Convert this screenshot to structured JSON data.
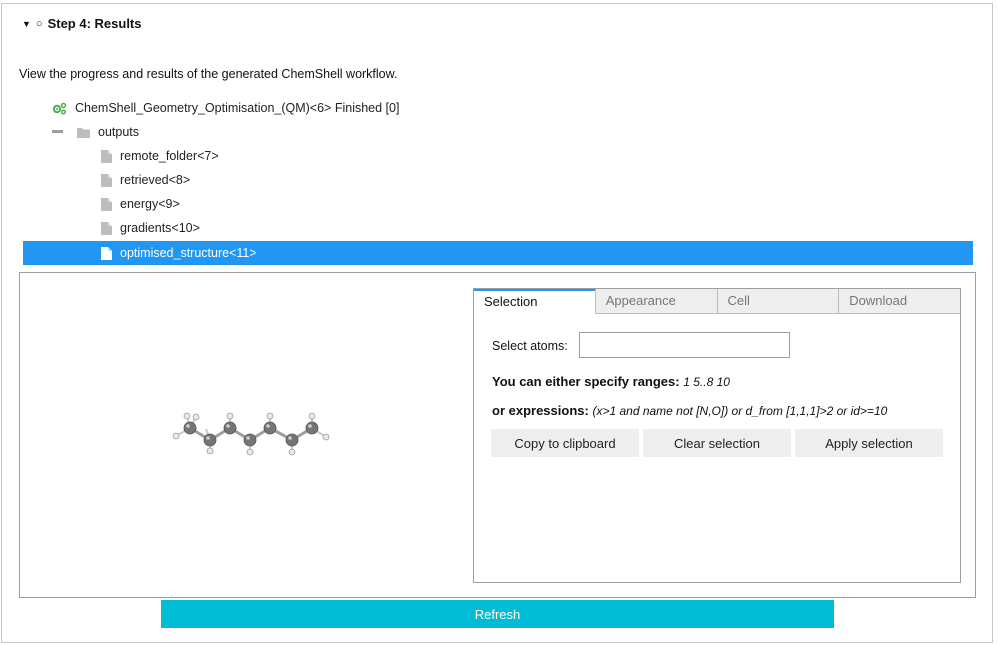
{
  "step": {
    "caret": "▼",
    "status_mark": "○",
    "title": "Step 4: Results"
  },
  "intro": "View the progress and results of the generated ChemShell workflow.",
  "tree": {
    "root": "ChemShell_Geometry_Optimisation_(QM)<6> Finished [0]",
    "folder": "outputs",
    "files": [
      "remote_folder<7>",
      "retrieved<8>",
      "energy<9>",
      "gradients<10>"
    ],
    "selected": "optimised_structure<11>"
  },
  "panel": {
    "tabs": [
      "Selection",
      "Appearance",
      "Cell",
      "Download"
    ],
    "select_label": "Select atoms:",
    "select_value": "",
    "ranges_label": "You can either specify ranges:",
    "ranges_example": "1 5..8 10",
    "expr_label": "or expressions:",
    "expr_example": "(x>1 and name not [N,O]) or d_from [1,1,1]>2 or id>=10",
    "buttons": {
      "copy": "Copy to clipboard",
      "clear": "Clear selection",
      "apply": "Apply selection"
    }
  },
  "refresh_label": "Refresh",
  "colors": {
    "accent": "#2196f3",
    "refresh": "#00bcd4",
    "gear": "#4caf50"
  }
}
